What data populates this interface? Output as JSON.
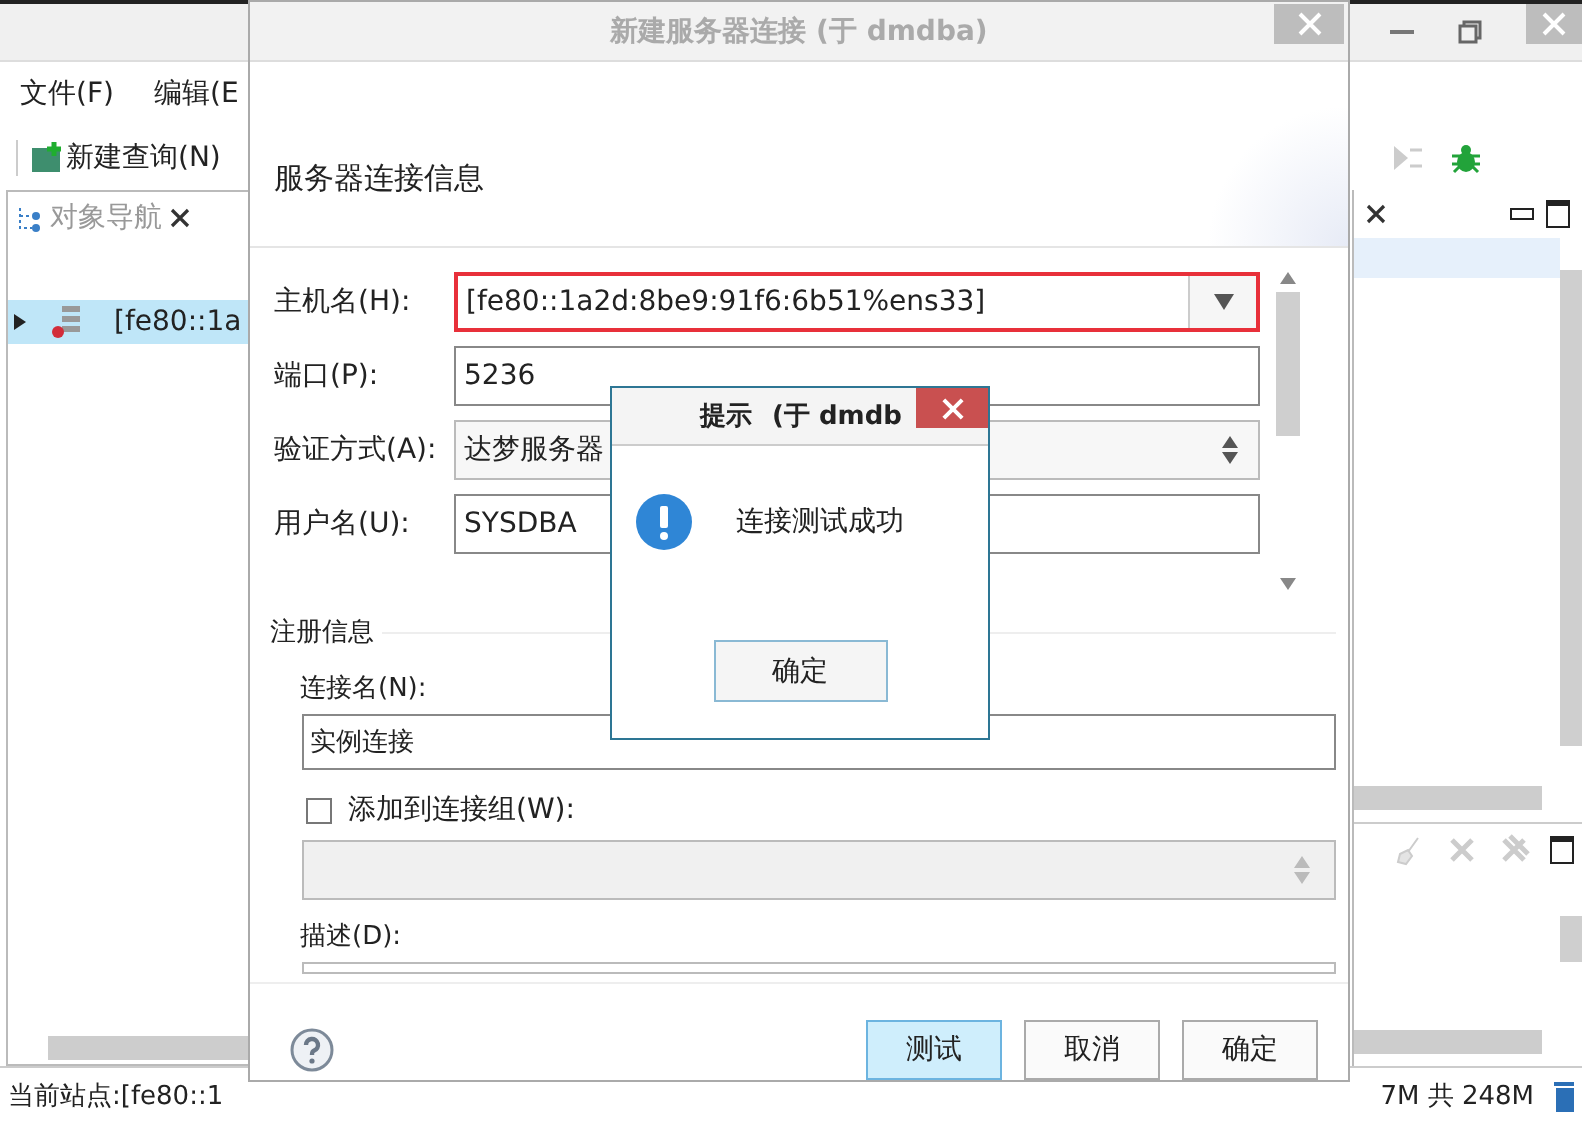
{
  "app": {
    "menu": [
      "文件(F)",
      "编辑(E"
    ],
    "toolbar": {
      "new_query": "新建查询(N)"
    },
    "nav_tab": {
      "label": "对象导航"
    },
    "tree": [
      {
        "label": "[fe80::1a",
        "selected": true,
        "expanded": false
      }
    ],
    "status_left": "当前站点:[fe80::1",
    "status_right": "7M 共 248M"
  },
  "dialog": {
    "title": "新建服务器连接 (于 dmdba)",
    "section": "服务器连接信息",
    "fields": [
      {
        "kind": "combo",
        "label": "主机名(H):",
        "value": "[fe80::1a2d:8be9:91f6:6b51%ens33]",
        "highlighted": true
      },
      {
        "kind": "text",
        "label": "端口(P):",
        "value": "5236",
        "highlighted": false
      },
      {
        "kind": "select",
        "label": "验证方式(A):",
        "value": "达梦服务器",
        "highlighted": false
      },
      {
        "kind": "text",
        "label": "用户名(U):",
        "value": "SYSDBA",
        "highlighted": false
      }
    ],
    "register": {
      "title": "注册信息",
      "conn_label": "连接名(N):",
      "conn_value": "实例连接",
      "group_label": "添加到连接组(W):",
      "group_checked": false,
      "desc_label": "描述(D):"
    },
    "buttons": [
      {
        "label": "测试",
        "selected": true
      },
      {
        "label": "取消",
        "selected": false
      },
      {
        "label": "确定",
        "selected": false
      }
    ]
  },
  "message": {
    "title": "提示",
    "title_suffix": "(于 dmdb",
    "text": "连接测试成功",
    "button": "确定"
  }
}
